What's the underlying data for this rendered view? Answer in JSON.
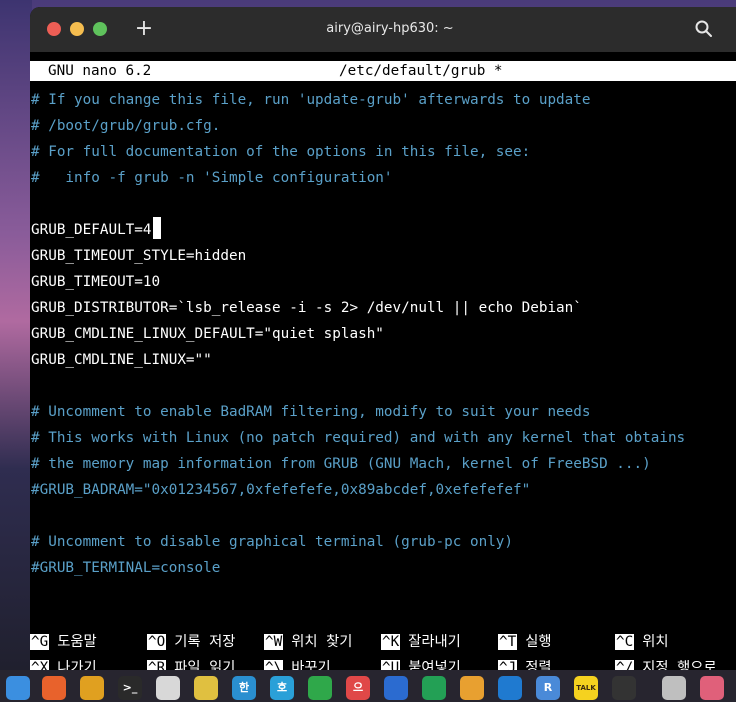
{
  "window": {
    "title": "airy@airy-hp630: ~",
    "new_tab_label": "+"
  },
  "nano": {
    "version": "GNU nano 6.2",
    "filename": "/etc/default/grub *"
  },
  "lines": [
    {
      "text": "# If you change this file, run 'update-grub' afterwards to update",
      "type": "comment"
    },
    {
      "text": "# /boot/grub/grub.cfg.",
      "type": "comment"
    },
    {
      "text": "# For full documentation of the options in this file, see:",
      "type": "comment"
    },
    {
      "text": "#   info -f grub -n 'Simple configuration'",
      "type": "comment"
    },
    {
      "text": "",
      "type": "blank"
    },
    {
      "text": "GRUB_DEFAULT=4",
      "type": "code",
      "cursor": true
    },
    {
      "text": "GRUB_TIMEOUT_STYLE=hidden",
      "type": "code"
    },
    {
      "text": "GRUB_TIMEOUT=10",
      "type": "code"
    },
    {
      "text": "GRUB_DISTRIBUTOR=`lsb_release -i -s 2> /dev/null || echo Debian`",
      "type": "code"
    },
    {
      "text": "GRUB_CMDLINE_LINUX_DEFAULT=\"quiet splash\"",
      "type": "code"
    },
    {
      "text": "GRUB_CMDLINE_LINUX=\"\"",
      "type": "code"
    },
    {
      "text": "",
      "type": "blank"
    },
    {
      "text": "# Uncomment to enable BadRAM filtering, modify to suit your needs",
      "type": "comment"
    },
    {
      "text": "# This works with Linux (no patch required) and with any kernel that obtains",
      "type": "comment"
    },
    {
      "text": "# the memory map information from GRUB (GNU Mach, kernel of FreeBSD ...)",
      "type": "comment"
    },
    {
      "text": "#GRUB_BADRAM=\"0x01234567,0xfefefefe,0x89abcdef,0xefefefef\"",
      "type": "comment"
    },
    {
      "text": "",
      "type": "blank"
    },
    {
      "text": "# Uncomment to disable graphical terminal (grub-pc only)",
      "type": "comment"
    },
    {
      "text": "#GRUB_TERMINAL=console",
      "type": "comment"
    }
  ],
  "shortcuts": [
    [
      {
        "key": "^G",
        "label": "도움말"
      },
      {
        "key": "^O",
        "label": "기록 저장"
      },
      {
        "key": "^W",
        "label": "위치 찾기"
      },
      {
        "key": "^K",
        "label": "잘라내기"
      },
      {
        "key": "^T",
        "label": "실행"
      },
      {
        "key": "^C",
        "label": "위치"
      }
    ],
    [
      {
        "key": "^X",
        "label": "나가기"
      },
      {
        "key": "^R",
        "label": "파일 읽기"
      },
      {
        "key": "^\\",
        "label": "바꾸기"
      },
      {
        "key": "^U",
        "label": "붙여넣기"
      },
      {
        "key": "^J",
        "label": "정렬"
      },
      {
        "key": "^/",
        "label": "지정 행으로"
      }
    ]
  ],
  "dock": [
    {
      "name": "finder-icon",
      "glyph": "",
      "color": "#3b8fe0"
    },
    {
      "name": "firefox-icon",
      "glyph": "",
      "color": "#e8622c"
    },
    {
      "name": "chrome-icon",
      "glyph": "",
      "color": "#e0a020"
    },
    {
      "name": "terminal-icon",
      "glyph": ">_",
      "color": "#2a2a2a"
    },
    {
      "name": "text-editor-icon",
      "glyph": "",
      "color": "#d8d8d8"
    },
    {
      "name": "preview-icon",
      "glyph": "",
      "color": "#e0c040"
    },
    {
      "name": "hangul-icon",
      "glyph": "한",
      "color": "#2a8fd0"
    },
    {
      "name": "hangul-show-icon",
      "glyph": "호",
      "color": "#2aa0d8"
    },
    {
      "name": "numbers-icon",
      "glyph": "",
      "color": "#2fa84a"
    },
    {
      "name": "hancell-icon",
      "glyph": "으",
      "color": "#e04848"
    },
    {
      "name": "word-icon",
      "glyph": "",
      "color": "#2b6bd0"
    },
    {
      "name": "excel-icon",
      "glyph": "",
      "color": "#23a055"
    },
    {
      "name": "photos-icon",
      "glyph": "",
      "color": "#e8a030"
    },
    {
      "name": "vscode-icon",
      "glyph": "",
      "color": "#1f7ad0"
    },
    {
      "name": "rstudio-icon",
      "glyph": "R",
      "color": "#4a8ad8"
    },
    {
      "name": "kakaotalk-icon",
      "glyph": "TALK",
      "color": "#f5d21f"
    },
    {
      "name": "remote-desktop-icon",
      "glyph": "",
      "color": "#333"
    },
    {
      "name": "trash-icon",
      "glyph": "",
      "color": "#bfbfbf"
    },
    {
      "name": "app-grid-icon",
      "glyph": "",
      "color": "#e0607a"
    }
  ]
}
